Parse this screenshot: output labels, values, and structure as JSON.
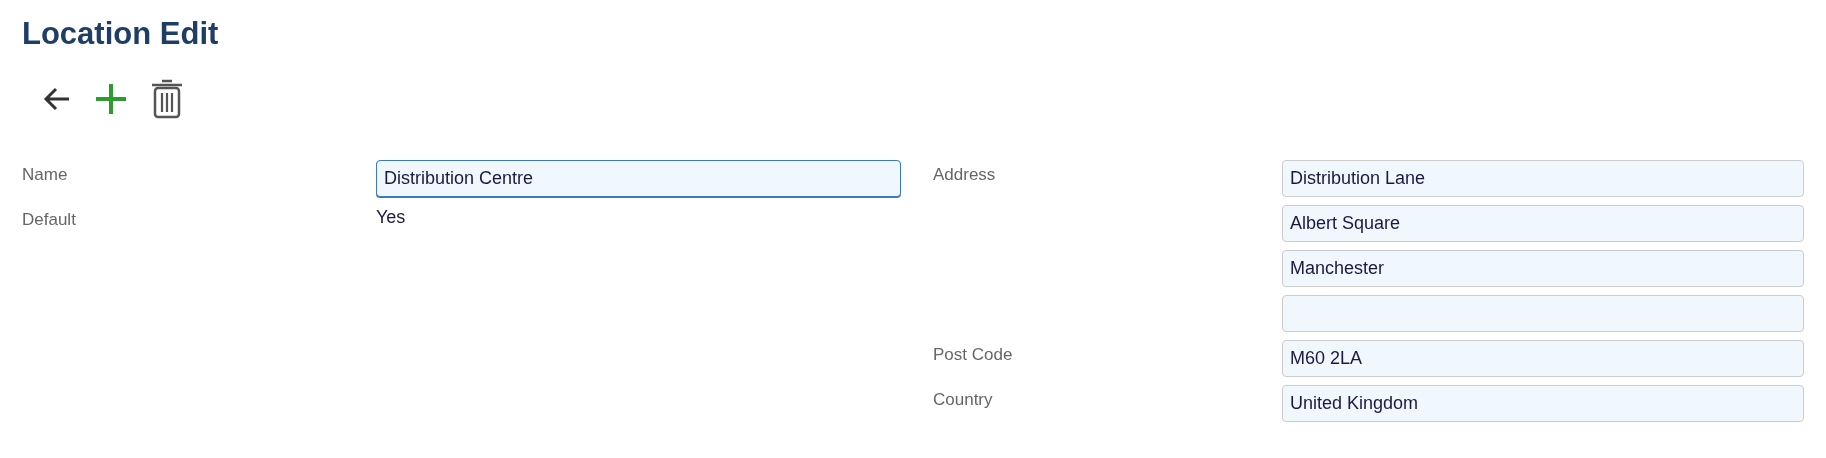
{
  "title": "Location Edit",
  "left_fields": [
    {
      "kind": "input",
      "label": "Name",
      "value": "Distribution Centre",
      "focused": true
    },
    {
      "kind": "text",
      "label": "Default",
      "value": "Yes"
    }
  ],
  "right_fields": [
    {
      "kind": "input",
      "label": "Address",
      "value": "Distribution Lane",
      "focused": false
    },
    {
      "kind": "input",
      "value": "Albert Square",
      "focused": false
    },
    {
      "kind": "input",
      "value": "Manchester",
      "focused": false
    },
    {
      "kind": "input",
      "focused": false
    },
    {
      "kind": "input",
      "label": "Post Code",
      "value": "M60 2LA",
      "focused": false
    },
    {
      "kind": "input",
      "label": "Country",
      "value": "United Kingdom",
      "focused": false
    }
  ]
}
